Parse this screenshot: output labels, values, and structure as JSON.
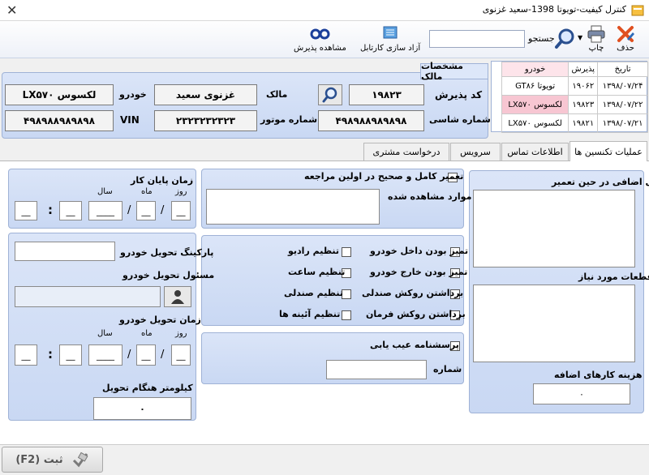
{
  "window": {
    "title": "کنترل کیفیت-تویوتا 1398-سعید غزنوی",
    "close": "✕"
  },
  "toolbar": {
    "delete": "حذف",
    "print": "چاپ",
    "search": "جستجو",
    "release": "آزاد سازی کارتابل",
    "view_reception": "مشاهده پذیرش"
  },
  "grid": {
    "headers": [
      "تاریخ",
      "پذیرش",
      "خودرو"
    ],
    "rows": [
      [
        "۱۳۹۸/۰۷/۲۴",
        "۱۹۰۶۲",
        "تویوتا GT۸۶"
      ],
      [
        "۱۳۹۸/۰۷/۲۲",
        "۱۹۸۲۳",
        "لکسوس LX۵۷۰"
      ],
      [
        "۱۳۹۸/۰۷/۲۱",
        "۱۹۸۲۱",
        "لکسوس LX۵۷۰"
      ]
    ]
  },
  "owner": {
    "section_title": "مشخصات مالک",
    "reception_code_label": "کد پذیرش",
    "reception_code": "۱۹۸۲۳",
    "owner_label": "مالک",
    "owner_name": "غزنوی سعید",
    "car_label": "خودرو",
    "car": "LX۵۷۰ لکسوس",
    "chassis_label": "شماره شاسی",
    "chassis": "۴۹۸۹۸۸۹۸۹۸۹۸",
    "engine_label": "شماره موتور",
    "engine": "۲۳۲۳۲۳۲۳۲۳",
    "vin_label": "VIN",
    "vin": "۴۹۸۹۸۸۹۸۹۸۹۸"
  },
  "tabs": [
    "عملیات تکنسین ها",
    "اطلاعات تماس",
    "سرویس",
    "درخواست مشتری"
  ],
  "right_panel": {
    "extra_works": "کارهای اضافی در حین تعمیر",
    "parts": "قطعات مورد نیاز",
    "extra_cost_label": "هزینه کارهای اضافه",
    "extra_cost": "۰"
  },
  "middle": {
    "full_repair": "تعمیر کامل و صحیح در اولین مراجعه",
    "observed": "موارد مشاهده شده",
    "checks": [
      "تمیز بودن داخل خودرو",
      "تنظیم رادیو",
      "تمیز بودن خارج خودرو",
      "تنظیم ساعت",
      "برداشتن روکش صندلی",
      "تنظیم صندلی",
      "برداشتن روکش فرمان",
      "تنظیم آئینه ها"
    ],
    "fault_form": "پرسشنامه عیب یابی",
    "number_label": "شماره"
  },
  "left": {
    "end_time": "زمان پایان کار",
    "day": "روز",
    "month": "ماه",
    "year": "سال",
    "parking": "پارکینگ تحویل خودرو",
    "delivery_resp": "مسئول تحویل خودرو",
    "delivery_time": "زمان تحویل خودرو",
    "km_label": "کیلومتر هنگام تحویل",
    "km": "۰",
    "sep_slash": "/",
    "sep_colon": ":"
  },
  "submit": "(F2) ثبت"
}
